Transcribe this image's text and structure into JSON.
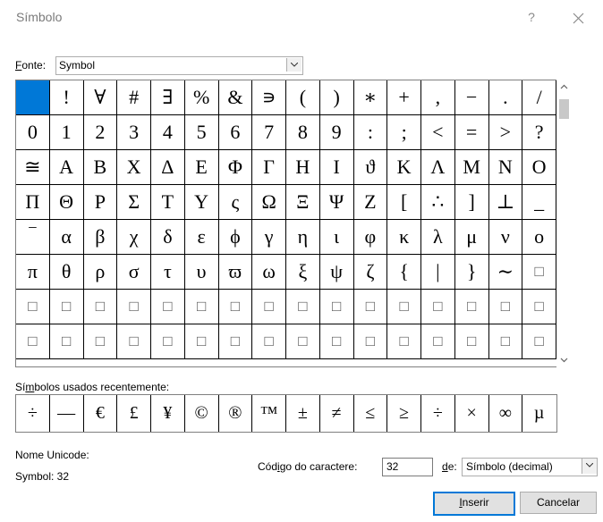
{
  "dialog": {
    "title": "Símbolo",
    "help_glyph": "?"
  },
  "font": {
    "label": "Fonte:",
    "value": "Symbol"
  },
  "grid_rows": [
    [
      " ",
      "!",
      "∀",
      "#",
      "∃",
      "%",
      "&",
      "∍",
      "(",
      ")",
      "∗",
      "+",
      ",",
      "−",
      ".",
      "/"
    ],
    [
      "0",
      "1",
      "2",
      "3",
      "4",
      "5",
      "6",
      "7",
      "8",
      "9",
      ":",
      ";",
      "<",
      "=",
      ">",
      "?"
    ],
    [
      "≅",
      "Α",
      "Β",
      "Χ",
      "Δ",
      "Ε",
      "Φ",
      "Γ",
      "Η",
      "Ι",
      "ϑ",
      "Κ",
      "Λ",
      "Μ",
      "Ν",
      "Ο"
    ],
    [
      "Π",
      "Θ",
      "Ρ",
      "Σ",
      "Τ",
      "Υ",
      "ς",
      "Ω",
      "Ξ",
      "Ψ",
      "Ζ",
      "[",
      "∴",
      "]",
      "⊥",
      "_"
    ],
    [
      "‾",
      "α",
      "β",
      "χ",
      "δ",
      "ε",
      "ϕ",
      "γ",
      "η",
      "ι",
      "φ",
      "κ",
      "λ",
      "μ",
      "ν",
      "ο"
    ],
    [
      "π",
      "θ",
      "ρ",
      "σ",
      "τ",
      "υ",
      "ϖ",
      "ω",
      "ξ",
      "ψ",
      "ζ",
      "{",
      "|",
      "}",
      "∼",
      "□"
    ],
    [
      "□",
      "□",
      "□",
      "□",
      "□",
      "□",
      "□",
      "□",
      "□",
      "□",
      "□",
      "□",
      "□",
      "□",
      "□",
      "□"
    ],
    [
      "□",
      "□",
      "□",
      "□",
      "□",
      "□",
      "□",
      "□",
      "□",
      "□",
      "□",
      "□",
      "□",
      "□",
      "□",
      "□"
    ]
  ],
  "recent": {
    "label": "Símbolos usados recentemente:",
    "symbols": [
      "÷",
      "—",
      "€",
      "£",
      "¥",
      "©",
      "®",
      "™",
      "±",
      "≠",
      "≤",
      "≥",
      "÷",
      "×",
      "∞",
      "µ"
    ]
  },
  "unicode": {
    "label": "Nome Unicode:",
    "value": "Symbol: 32"
  },
  "code": {
    "label": "Código do caractere:",
    "value": "32",
    "from_label": "de:",
    "from_value": "Símbolo (decimal)"
  },
  "buttons": {
    "insert": "Inserir",
    "cancel": "Cancelar"
  },
  "colors": {
    "selection": "#0078d7",
    "default_button_border": "#0078d7"
  },
  "selected_index": 0
}
